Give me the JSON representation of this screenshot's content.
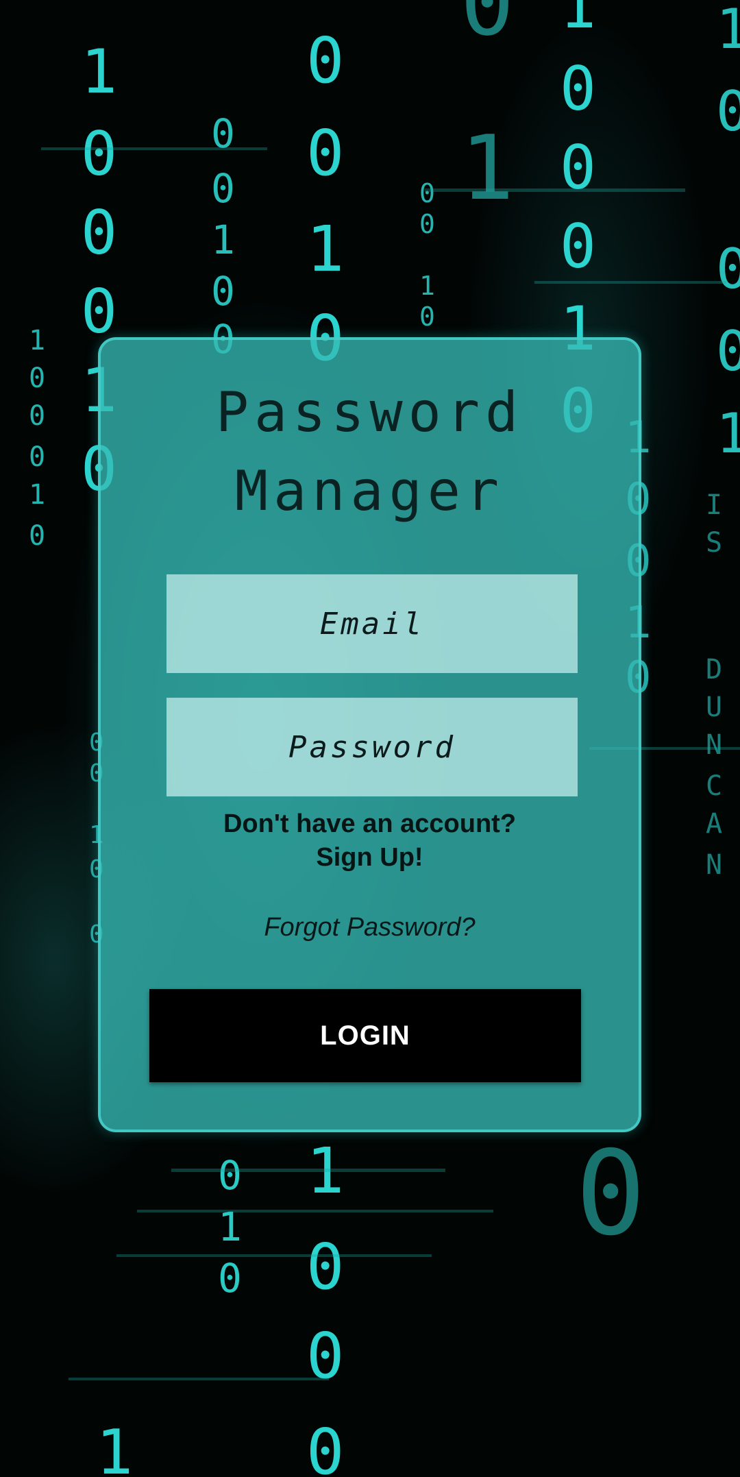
{
  "app": {
    "title_line1": "Password",
    "title_line2": "Manager"
  },
  "form": {
    "email_placeholder": "Email",
    "password_placeholder": "Password",
    "signup_line1": "Don't have an account?",
    "signup_line2": "Sign Up!",
    "forgot_label": "Forgot Password?",
    "login_label": "LOGIN"
  },
  "colors": {
    "panel": "#36b8b4",
    "field": "#c8f0ee",
    "button": "#000000",
    "button_text": "#ffffff",
    "matrix_digits": "#2fe0da"
  },
  "background": {
    "style": "binary matrix rain",
    "watermark_text": "IS DUNCAN"
  }
}
